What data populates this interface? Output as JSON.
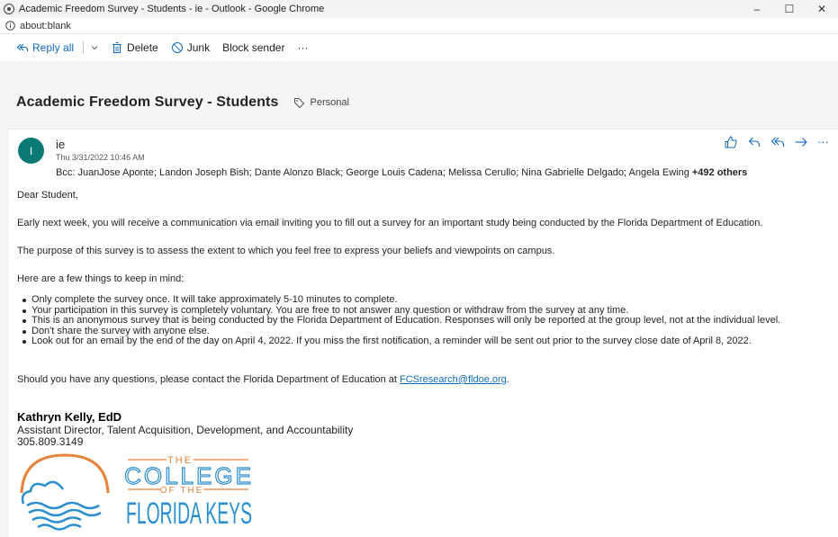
{
  "window": {
    "title": "Academic Freedom Survey - Students - ie - Outlook - Google Chrome",
    "minimize": "–",
    "maximize": "☐",
    "close": "✕"
  },
  "address": {
    "url": "about:blank"
  },
  "toolbar": {
    "reply_all": "Reply all",
    "delete": "Delete",
    "junk": "Junk",
    "block_sender": "Block sender",
    "more": "···"
  },
  "message": {
    "subject": "Academic Freedom Survey - Students",
    "category": "Personal",
    "avatar_initial": "I",
    "sender": "ie",
    "datetime": "Thu 3/31/2022 10:46 AM",
    "bcc_prefix": "Bcc: JuanJose Aponte;  Landon Joseph Bish;  Dante Alonzo Black;  George Louis Cadena;  Melissa Cerullo;  Nina Gabrielle Delgado;  Angela Ewing ",
    "bcc_more": "+492 others",
    "more_actions": "···"
  },
  "body": {
    "greeting": "Dear Student,",
    "p1": "Early next week, you will receive a communication via email inviting you to fill out a survey for an important study being conducted by the Florida Department of Education.",
    "p2": "The purpose of this survey is to assess the extent to which you feel free to express your beliefs and viewpoints on campus.",
    "p3": "Here are a few things to keep in mind:",
    "bullets": [
      "Only complete the survey once. It will take approximately 5-10 minutes to complete.",
      "Your participation in this survey is completely voluntary. You are free to not answer any question or withdraw from the survey at any time.",
      "This is an anonymous survey that is being conducted by the Florida Department of Education. Responses will only be reported at the group level, not at the individual level.",
      "Don't share the survey with anyone else.",
      "Look out for an email by the end of the day on April 4, 2022. If you miss the first notification, a reminder will be sent out prior to the survey close date of April 8, 2022."
    ],
    "contact_prefix": "Should you have any questions, please contact the Florida Department of Education at ",
    "contact_email": "FCSresearch@fldoe.org",
    "contact_suffix": "."
  },
  "signature": {
    "name": "Kathryn Kelly, EdD",
    "title": "Assistant Director, Talent Acquisition, Development, and Accountability",
    "phone": "305.809.3149",
    "logo_text": {
      "the": "THE",
      "college": "COLLEGE",
      "of_the": "OF THE",
      "florida_keys": "FLORIDA KEYS"
    }
  },
  "colors": {
    "accent": "#0f6cbd",
    "avatar": "#0b7a75",
    "logo_blue": "#2a8fd0",
    "logo_orange": "#e8843a"
  }
}
